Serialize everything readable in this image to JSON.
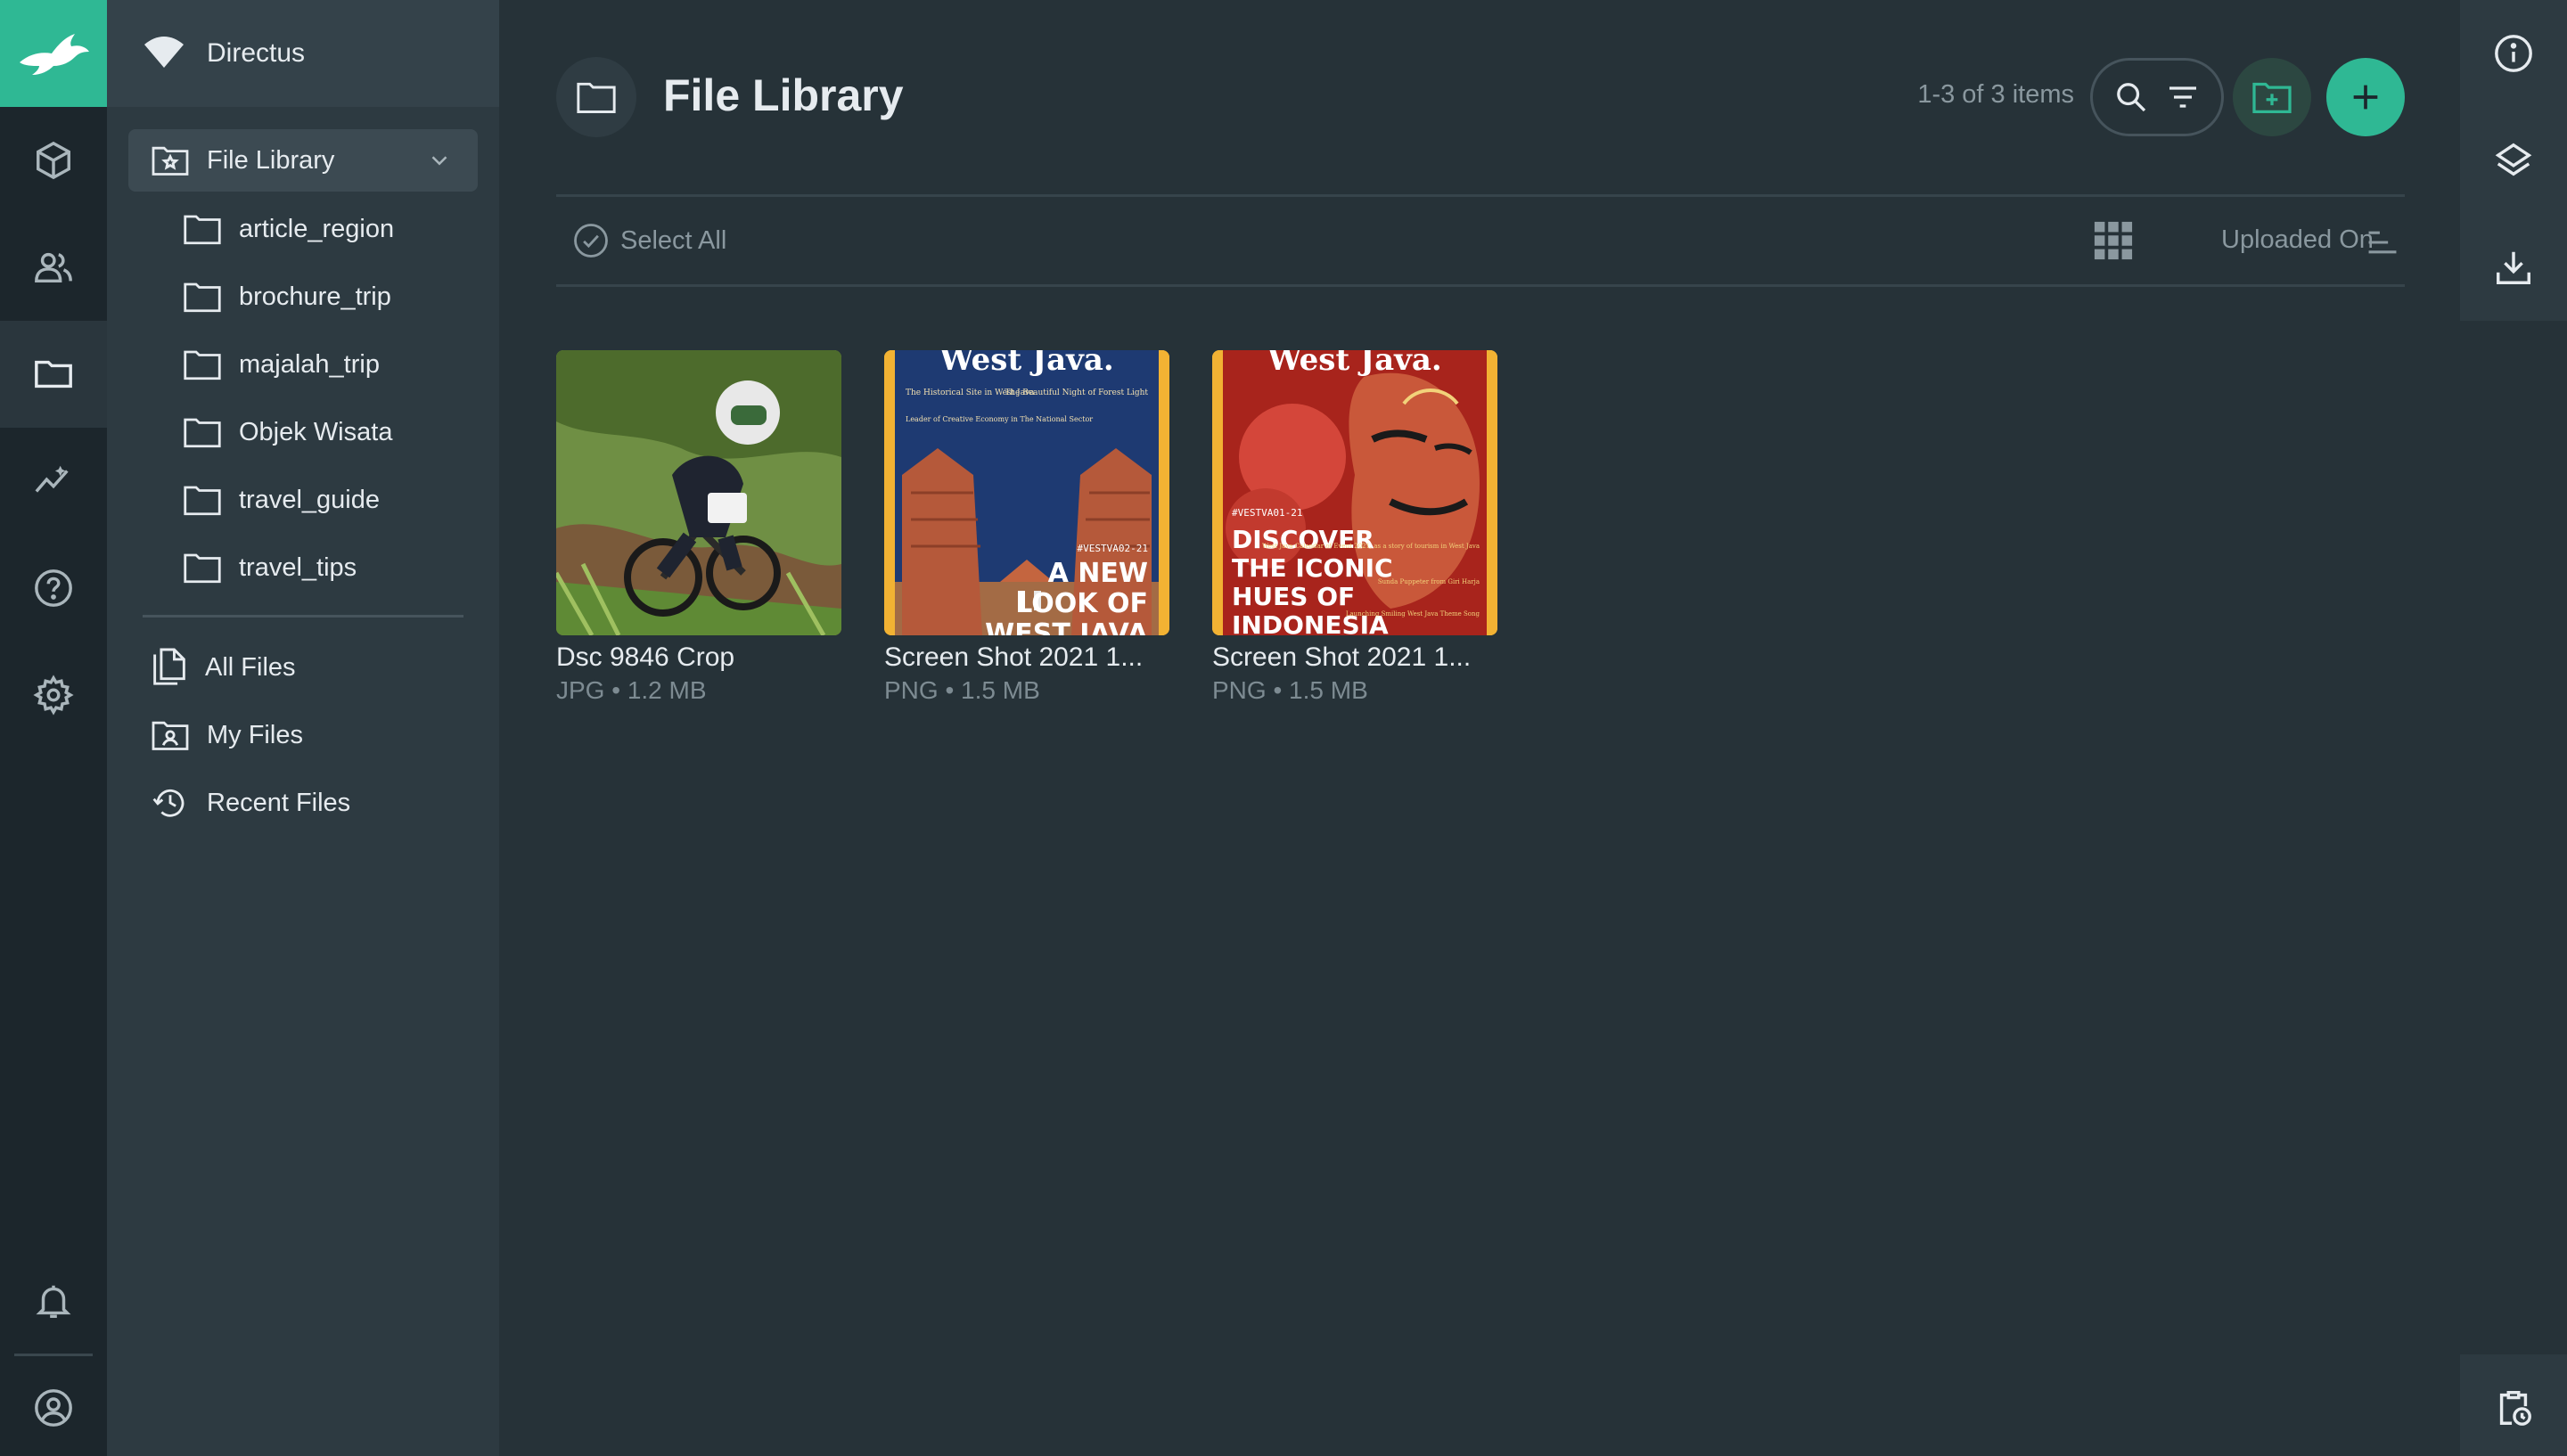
{
  "project": {
    "name": "Directus"
  },
  "navigation": {
    "current_folder": "File Library",
    "subfolders": [
      "article_region",
      "brochure_trip",
      "majalah_trip",
      "Objek Wisata",
      "travel_guide",
      "travel_tips"
    ],
    "special": [
      "All Files",
      "My Files",
      "Recent Files"
    ]
  },
  "header": {
    "title": "File Library",
    "item_count": "1-3 of 3 items"
  },
  "toolbar": {
    "select_all": "Select All",
    "sort_label": "Uploaded On"
  },
  "files": [
    {
      "title": "Dsc 9846 Crop",
      "meta": "JPG • 1.2 MB",
      "thumb": "mountain-bike-photo"
    },
    {
      "title": "Screen Shot 2021 1...",
      "meta": "PNG • 1.5 MB",
      "thumb": "west-java-magazine-cover"
    },
    {
      "title": "Screen Shot 2021 1...",
      "meta": "PNG • 1.5 MB",
      "thumb": "west-java-magazine-cover"
    }
  ],
  "thumbnails": {
    "cover2": {
      "masthead": "West Java.",
      "blurb_left": "The Historical Site in West Java",
      "blurb_right": "The Beautiful Night of Forest Light",
      "blurb_left2": "Leader of Creative Economy in The National Sector",
      "tag": "#VESTVA02-21",
      "headline": [
        "A NEW",
        "LOOK OF",
        "WEST JAVA"
      ]
    },
    "cover3": {
      "masthead": "West Java.",
      "tag": "#VESTVA01-21",
      "headline": [
        "DISCOVER",
        "THE ICONIC",
        "HUES OF",
        "INDONESIA"
      ],
      "blurb1": "West Java Calendar of Event 2021, as a story of tourism in West Java",
      "blurb2": "Sunda Puppeter from Giri Harja",
      "blurb3": "Launching Smiling West Java Theme Song"
    }
  },
  "colors": {
    "accent": "#2fb894",
    "background": "#263238",
    "nav_bg": "#2d3a41",
    "module_bg": "#1c262c"
  }
}
